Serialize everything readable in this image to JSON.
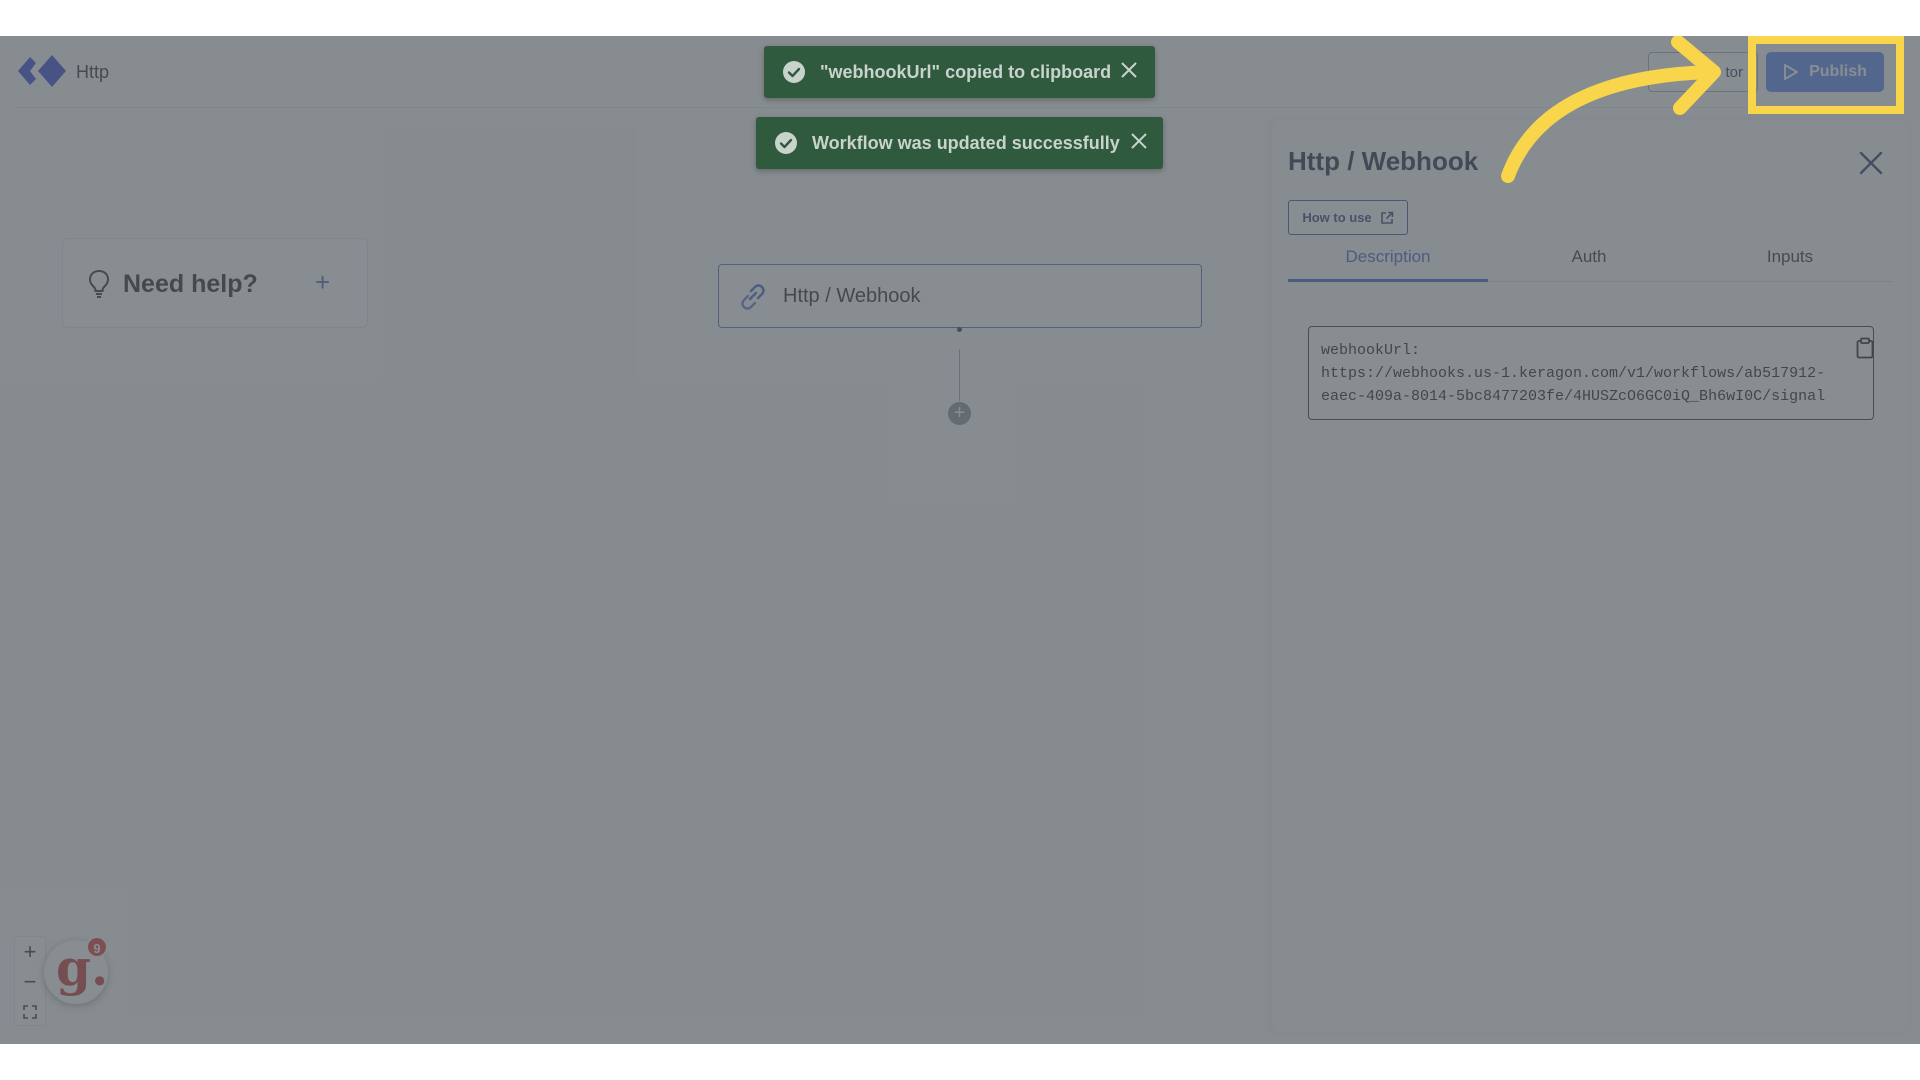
{
  "app": {
    "name": "Http"
  },
  "header": {
    "monitor_label": "tor",
    "publish_label": "Publish"
  },
  "toasts": [
    {
      "text": "\"webhookUrl\" copied to clipboard"
    },
    {
      "text": "Workflow was updated successfully"
    }
  ],
  "help": {
    "title": "Need help?",
    "plus": "+"
  },
  "node": {
    "title": "Http / Webhook",
    "add": "+"
  },
  "panel": {
    "title": "Http / Webhook",
    "how_to_use": "How to use",
    "tabs": [
      "Description",
      "Auth",
      "Inputs"
    ],
    "webhook_label": "webhookUrl:",
    "webhook_line1": "https://webhooks.us-1.keragon.com/v1/workflows/ab517912-",
    "webhook_line2": "eaec-409a-8014-5bc8477203fe/4HUSZcO6GC0iQ_Bh6wI0C/signal"
  },
  "zoom": {
    "in": "+",
    "out": "−"
  },
  "widget": {
    "letter": "g.",
    "badge": "9"
  },
  "colors": {
    "accent": "#4f7df2",
    "toast": "#2f5a3e",
    "highlight": "#f8d54a"
  }
}
